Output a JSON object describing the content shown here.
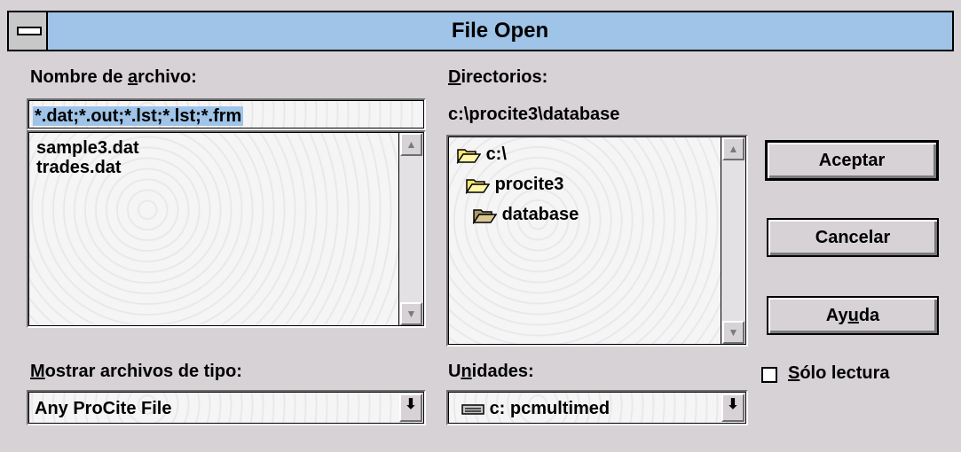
{
  "window": {
    "title": "File Open"
  },
  "filename": {
    "label_pre": "Nombre de ",
    "label_u": "a",
    "label_post": "rchivo:",
    "value": "*.dat;*.out;*.lst;*.lst;*.frm",
    "files": [
      "sample3.dat",
      "trades.dat"
    ]
  },
  "directories": {
    "label_u": "D",
    "label_post": "irectorios:",
    "current_path": "c:\\procite3\\database",
    "items": [
      {
        "name": "c:\\",
        "icon": "open-folder-icon"
      },
      {
        "name": "procite3",
        "icon": "open-folder-icon"
      },
      {
        "name": "database",
        "icon": "open-folder-icon"
      }
    ]
  },
  "file_type": {
    "label_u": "M",
    "label_post": "ostrar archivos de tipo:",
    "value": "Any ProCite File"
  },
  "drives": {
    "label_pre": "U",
    "label_u": "n",
    "label_post": "idades:",
    "value": "c: pcmultimed",
    "icon": "drive-icon"
  },
  "buttons": {
    "ok": "Aceptar",
    "cancel": "Cancelar",
    "help_pre": "Ay",
    "help_u": "u",
    "help_post": "da"
  },
  "readonly": {
    "label_u": "S",
    "label_post": "ólo lectura",
    "checked": false
  }
}
